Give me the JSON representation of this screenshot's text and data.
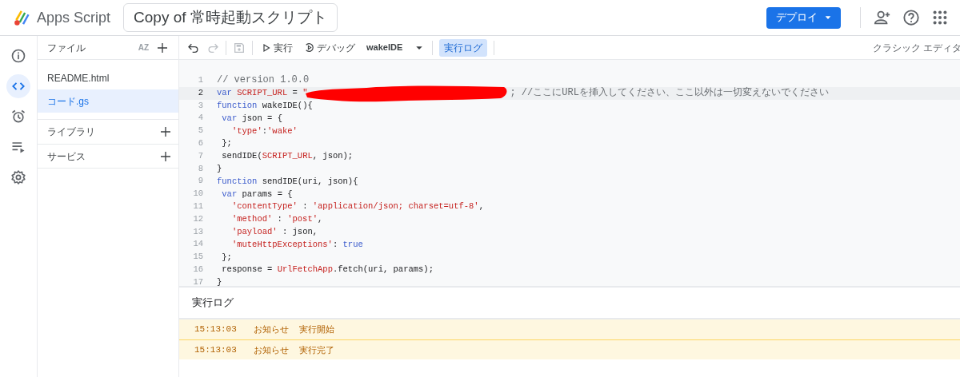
{
  "header": {
    "app_name": "Apps Script",
    "project_title": "Copy of 常時起動スクリプト",
    "deploy_button": "デプロイ",
    "actions": [
      {
        "kind": "add-person"
      },
      {
        "kind": "help"
      },
      {
        "kind": "apps"
      }
    ]
  },
  "rail": [
    {
      "kind": "info",
      "selected": false
    },
    {
      "kind": "code",
      "selected": true
    },
    {
      "kind": "alarm",
      "selected": false
    },
    {
      "kind": "executions",
      "selected": false
    },
    {
      "kind": "settings",
      "selected": false
    }
  ],
  "files_panel": {
    "title": "ファイル",
    "sort_label": "AZ",
    "files": [
      {
        "name": "README.html",
        "selected": false
      },
      {
        "name": "コード.gs",
        "selected": true
      }
    ],
    "sections": [
      {
        "title": "ライブラリ"
      },
      {
        "title": "サービス"
      }
    ]
  },
  "toolbar": {
    "undo": {
      "disabled": false
    },
    "redo": {
      "disabled": true
    },
    "save": {
      "disabled": true
    },
    "run_label": "実行",
    "debug_label": "デバッグ",
    "function_name": "wakeIDE",
    "log_toggle": {
      "label": "実行ログ",
      "selected": true
    },
    "classic_editor": "クラシック エディタ"
  },
  "code": [
    {
      "number": "1",
      "current": false,
      "tokens": [
        {
          "kind": "comment",
          "text": "// version 1.0.0"
        }
      ]
    },
    {
      "number": "2",
      "current": true,
      "tokens": [
        {
          "kind": "keyword",
          "text": "var"
        },
        {
          "kind": "string",
          "text": " SCRIPT_URL"
        },
        {
          "kind": "plain",
          "text": " = "
        },
        {
          "kind": "string",
          "text": "\""
        },
        {
          "kind": "redaction"
        },
        {
          "kind": "comment",
          "text": "; //ここにURLを挿入してください、ここ以外は一切変えないでください"
        }
      ]
    },
    {
      "number": "3",
      "current": false,
      "tokens": [
        {
          "kind": "keyword",
          "text": "function"
        },
        {
          "kind": "plain",
          "text": " wakeIDE(){"
        }
      ]
    },
    {
      "number": "4",
      "current": false,
      "tokens": [
        {
          "kind": "keyword",
          "text": " var"
        },
        {
          "kind": "plain",
          "text": " json = {"
        }
      ]
    },
    {
      "number": "5",
      "current": false,
      "tokens": [
        {
          "kind": "string",
          "text": "   'type'"
        },
        {
          "kind": "plain",
          "text": ":"
        },
        {
          "kind": "string",
          "text": "'wake'"
        }
      ]
    },
    {
      "number": "6",
      "current": false,
      "tokens": [
        {
          "kind": "plain",
          "text": " };"
        }
      ]
    },
    {
      "number": "7",
      "current": false,
      "tokens": [
        {
          "kind": "plain",
          "text": " sendIDE("
        },
        {
          "kind": "string",
          "text": "SCRIPT_URL"
        },
        {
          "kind": "plain",
          "text": ", json);"
        }
      ]
    },
    {
      "number": "8",
      "current": false,
      "tokens": [
        {
          "kind": "plain",
          "text": "}"
        }
      ]
    },
    {
      "number": "9",
      "current": false,
      "tokens": [
        {
          "kind": "keyword",
          "text": "function"
        },
        {
          "kind": "plain",
          "text": " sendIDE(uri, json){"
        }
      ]
    },
    {
      "number": "10",
      "current": false,
      "tokens": [
        {
          "kind": "keyword",
          "text": " var"
        },
        {
          "kind": "plain",
          "text": " params = {"
        }
      ]
    },
    {
      "number": "11",
      "current": false,
      "tokens": [
        {
          "kind": "string",
          "text": "   'contentType'"
        },
        {
          "kind": "plain",
          "text": " : "
        },
        {
          "kind": "string",
          "text": "'application/json; charset=utf-8'"
        },
        {
          "kind": "plain",
          "text": ","
        }
      ]
    },
    {
      "number": "12",
      "current": false,
      "tokens": [
        {
          "kind": "string",
          "text": "   'method'"
        },
        {
          "kind": "plain",
          "text": " : "
        },
        {
          "kind": "string",
          "text": "'post'"
        },
        {
          "kind": "plain",
          "text": ","
        }
      ]
    },
    {
      "number": "13",
      "current": false,
      "tokens": [
        {
          "kind": "string",
          "text": "   'payload'"
        },
        {
          "kind": "plain",
          "text": " : json,"
        }
      ]
    },
    {
      "number": "14",
      "current": false,
      "tokens": [
        {
          "kind": "string",
          "text": "   'muteHttpExceptions'"
        },
        {
          "kind": "plain",
          "text": ": "
        },
        {
          "kind": "keyword",
          "text": "true"
        }
      ]
    },
    {
      "number": "15",
      "current": false,
      "tokens": [
        {
          "kind": "plain",
          "text": " };"
        }
      ]
    },
    {
      "number": "16",
      "current": false,
      "tokens": [
        {
          "kind": "plain",
          "text": " response = "
        },
        {
          "kind": "string",
          "text": "UrlFetchApp"
        },
        {
          "kind": "plain",
          "text": ".fetch(uri, params);"
        }
      ]
    },
    {
      "number": "17",
      "current": false,
      "tokens": [
        {
          "kind": "plain",
          "text": "}"
        }
      ]
    }
  ],
  "log": {
    "title": "実行ログ",
    "rows": [
      {
        "time": "15:13:03",
        "level": "お知らせ",
        "message": "実行開始"
      },
      {
        "time": "15:13:03",
        "level": "お知らせ",
        "message": "実行完了"
      }
    ]
  }
}
